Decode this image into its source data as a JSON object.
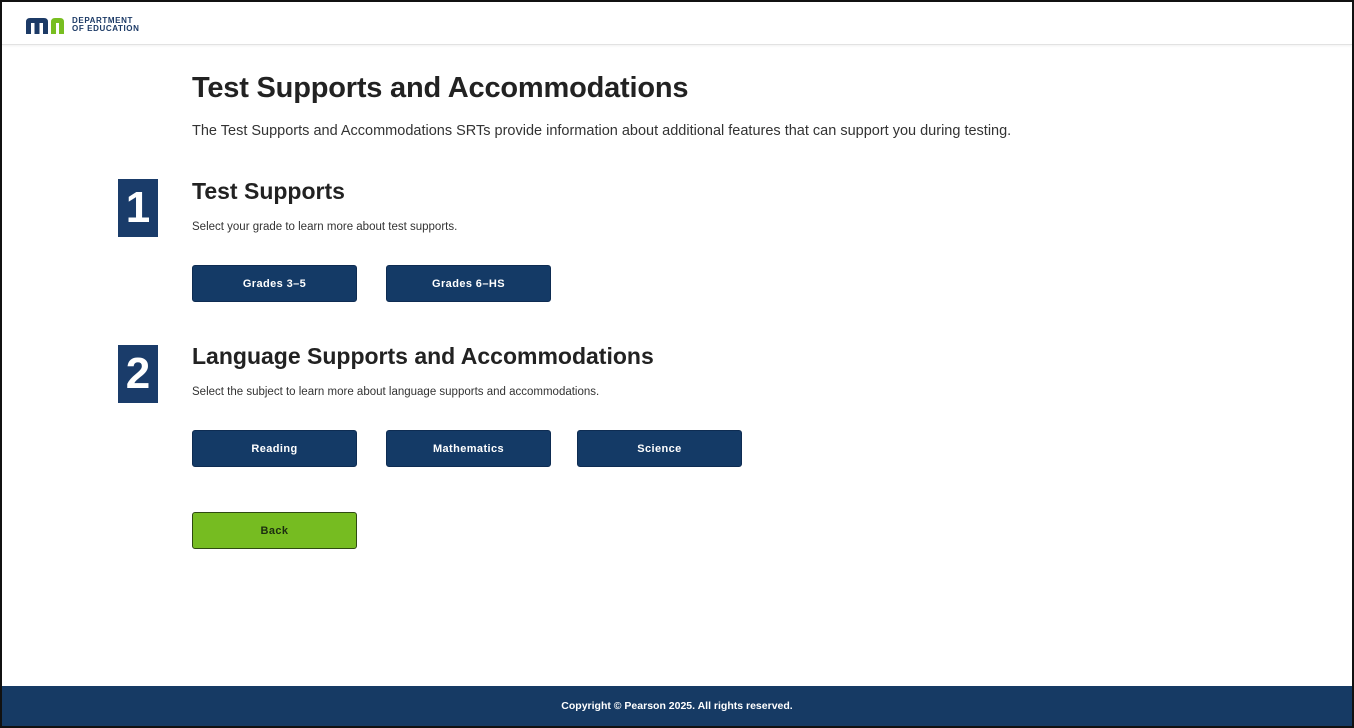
{
  "header": {
    "logo_line1": "DEPARTMENT",
    "logo_line2": "OF EDUCATION"
  },
  "page": {
    "title": "Test Supports and Accommodations",
    "intro": "The Test Supports and Accommodations SRTs provide information about additional features that can support you during testing."
  },
  "sections": [
    {
      "number": "1",
      "title": "Test Supports",
      "description": "Select your grade to learn more about test supports.",
      "buttons": [
        "Grades 3–5",
        "Grades 6–HS"
      ]
    },
    {
      "number": "2",
      "title": "Language Supports and Accommodations",
      "description": "Select the subject to learn more about language supports and accommodations.",
      "buttons": [
        "Reading",
        "Mathematics",
        "Science"
      ]
    }
  ],
  "back_label": "Back",
  "footer": {
    "copyright": "Copyright © Pearson 2025. All rights reserved."
  },
  "colors": {
    "navy": "#143a66",
    "green": "#76bc21",
    "logo_green": "#78be20"
  }
}
